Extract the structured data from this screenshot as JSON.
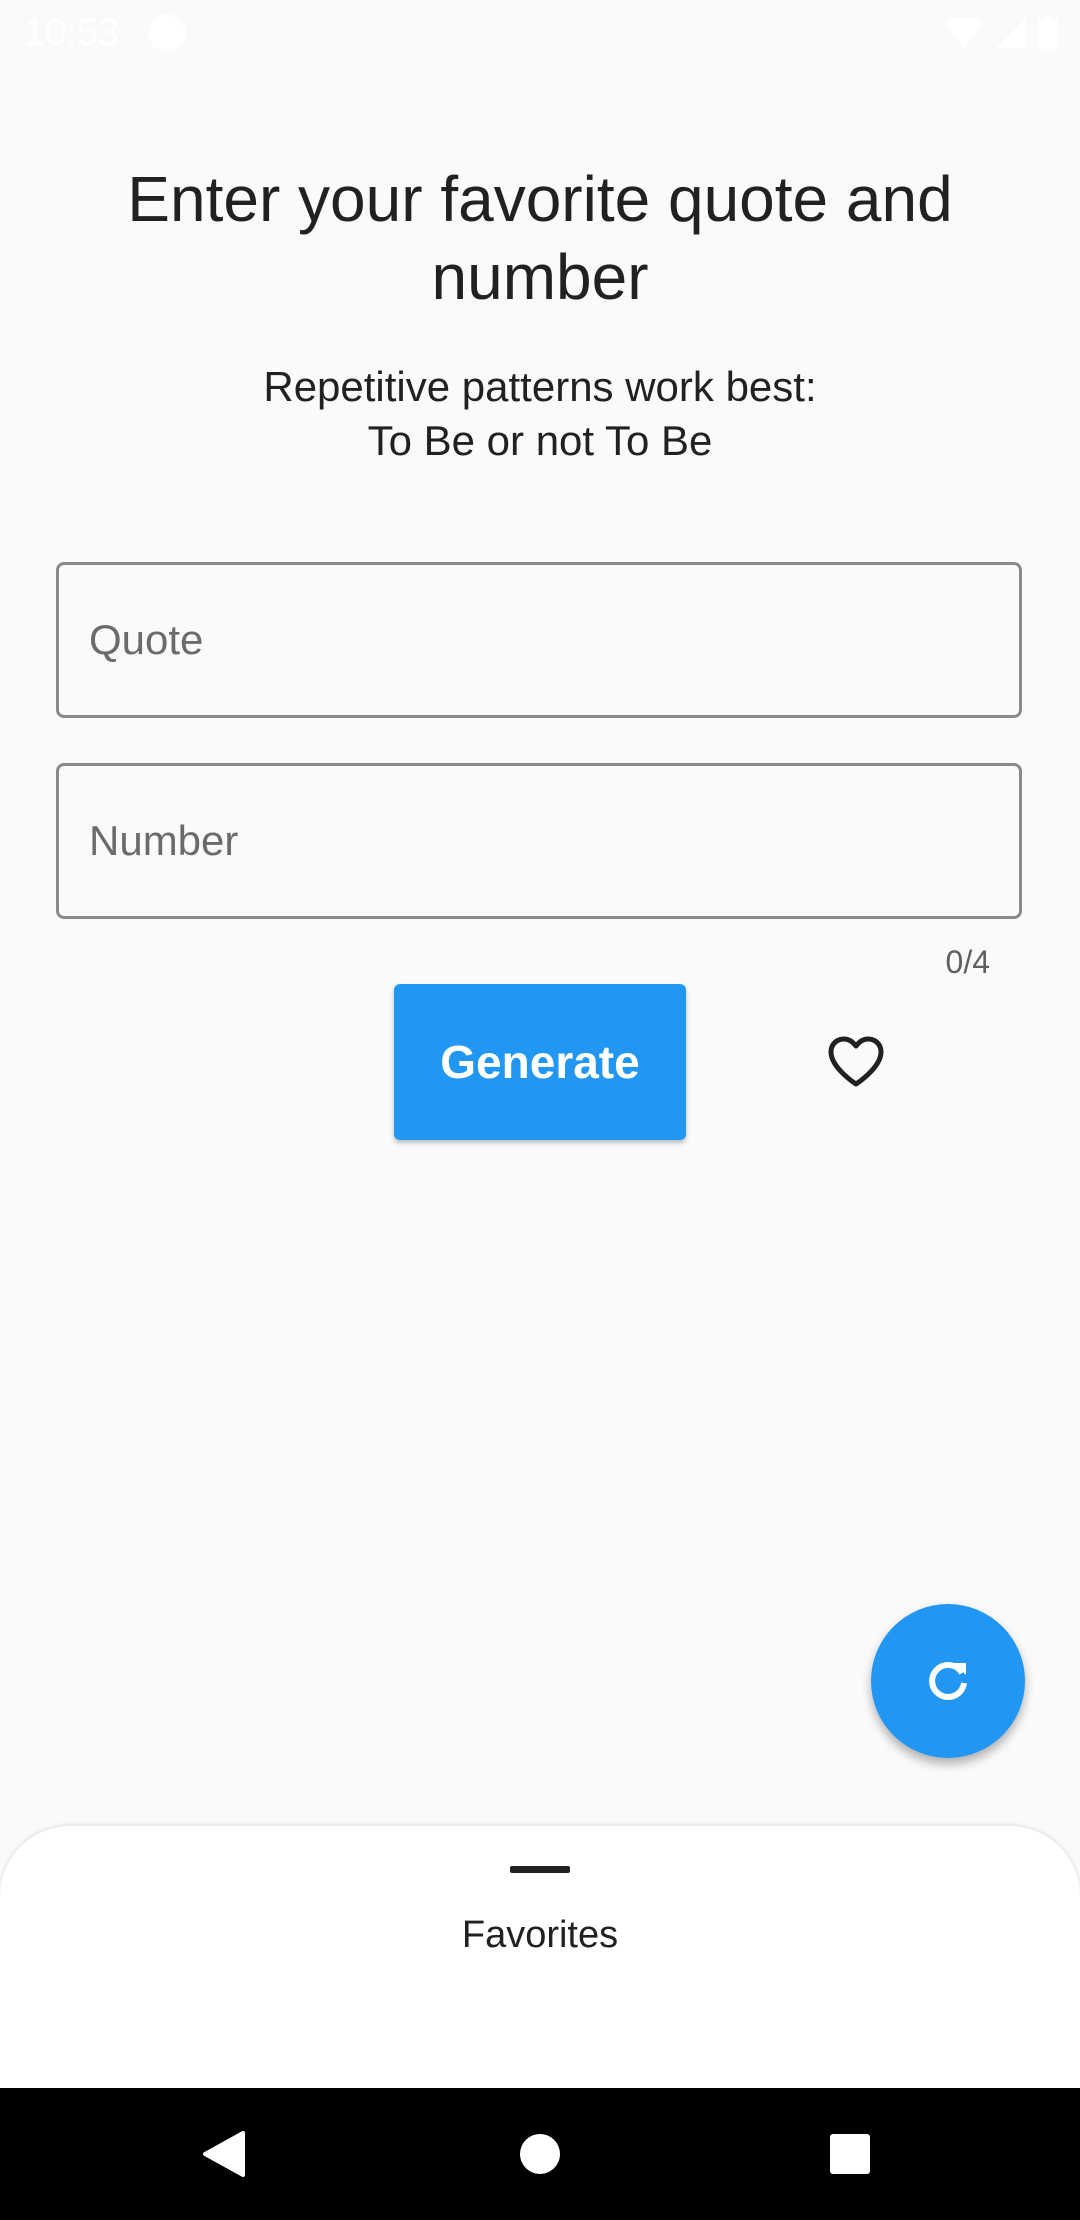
{
  "status_bar": {
    "time": "10:53"
  },
  "header": {
    "title": "Enter your favorite quote and number",
    "subtitle": "Repetitive patterns work best:\nTo Be or not To Be"
  },
  "form": {
    "quote": {
      "placeholder": "Quote",
      "value": ""
    },
    "number": {
      "placeholder": "Number",
      "value": ""
    },
    "counter": "0/4",
    "generate_label": "Generate",
    "favorite_icon": "heart-outline-icon"
  },
  "fab": {
    "icon": "refresh-icon"
  },
  "bottom_sheet": {
    "label": "Favorites"
  },
  "navigation": {
    "back_icon": "back-triangle-icon",
    "home_icon": "home-circle-icon",
    "recent_icon": "recents-square-icon"
  },
  "colors": {
    "accent": "#2196f3",
    "background": "#fafafa",
    "text": "#212121"
  }
}
